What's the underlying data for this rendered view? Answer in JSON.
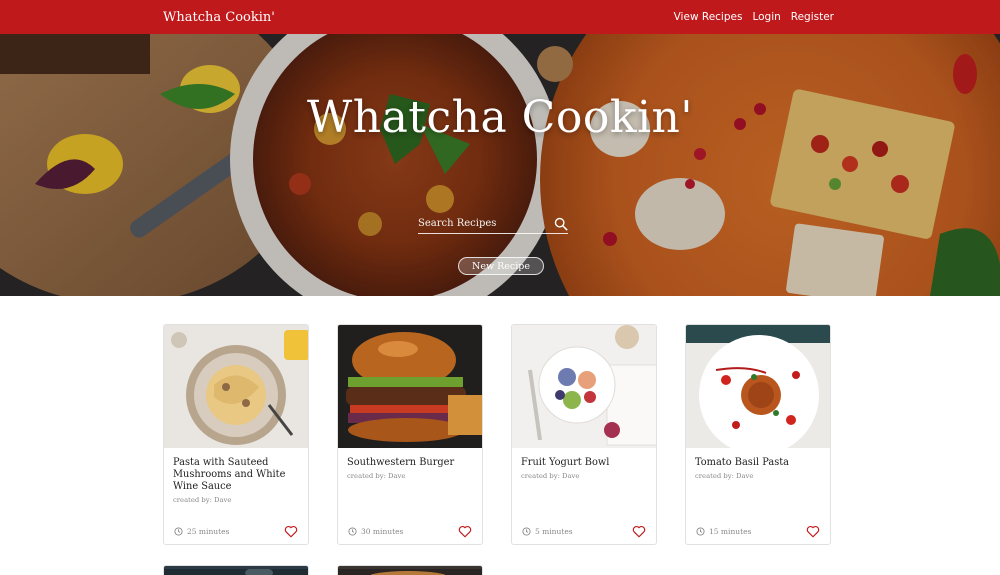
{
  "navbar": {
    "brand": "Whatcha Cookin'",
    "links": [
      "View Recipes",
      "Login",
      "Register"
    ],
    "bg_color": "#c0191c"
  },
  "hero": {
    "title": "Whatcha Cookin'",
    "search_placeholder": "Search Recipes",
    "search_icon": "search-icon",
    "new_recipe_label": "New Recipe"
  },
  "recipes": [
    {
      "title": "Pasta with Sauteed Mushrooms and White Wine Sauce",
      "author": "created by: Dave",
      "time": "25 minutes"
    },
    {
      "title": "Southwestern Burger",
      "author": "created by: Dave",
      "time": "30 minutes"
    },
    {
      "title": "Fruit Yogurt Bowl",
      "author": "created by: Dave",
      "time": "5 minutes"
    },
    {
      "title": "Tomato Basil Pasta",
      "author": "created by: Dave",
      "time": "15 minutes"
    }
  ],
  "colors": {
    "accent": "#c0191c",
    "heart": "#c0191c"
  }
}
